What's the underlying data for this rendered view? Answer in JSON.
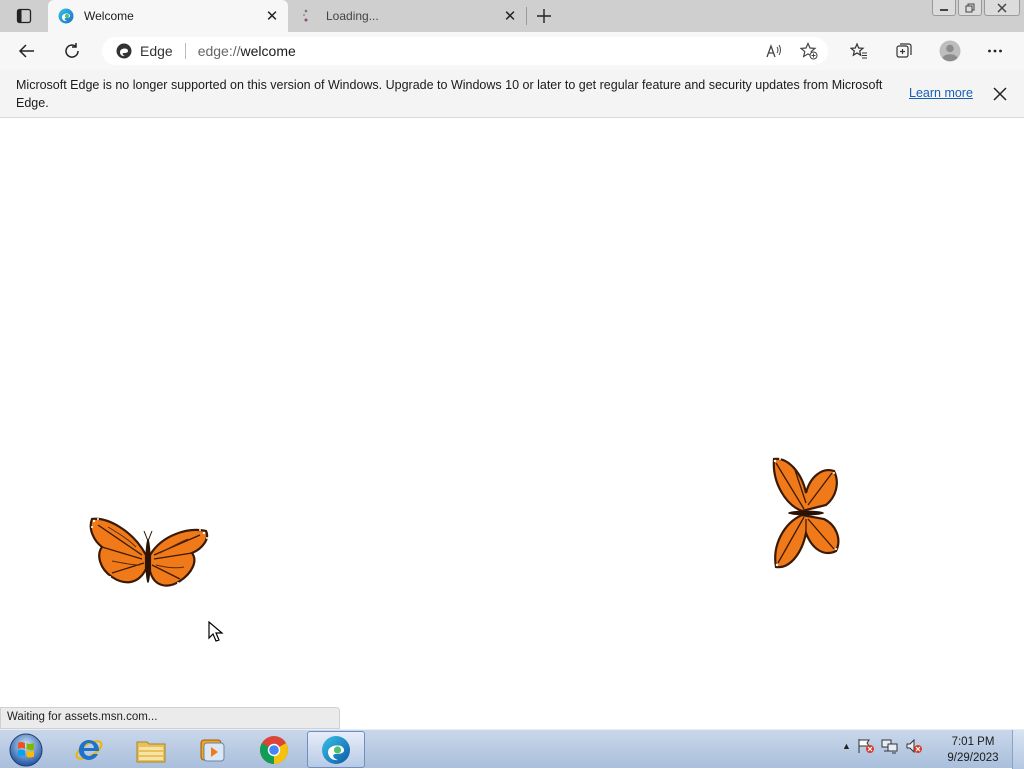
{
  "tabs": [
    {
      "title": "Welcome",
      "icon": "edge-icon",
      "active": true
    },
    {
      "title": "Loading...",
      "icon": "loading-spinner-icon",
      "active": false
    }
  ],
  "address_bar": {
    "site_label": "Edge",
    "url": "edge://welcome",
    "url_scheme": "edge://",
    "url_rest": "welcome"
  },
  "infobar": {
    "message": "Microsoft Edge is no longer supported on this version of Windows. Upgrade to Windows 10 or later to get regular feature and security updates from Microsoft Edge.",
    "link_label": "Learn more"
  },
  "status_text": "Waiting for assets.msn.com...",
  "taskbar": {
    "apps": [
      {
        "name": "internet-explorer-icon",
        "active": false
      },
      {
        "name": "file-explorer-icon",
        "active": false
      },
      {
        "name": "media-player-icon",
        "active": false
      },
      {
        "name": "chrome-icon",
        "active": false
      },
      {
        "name": "edge-icon",
        "active": true
      }
    ],
    "clock_time": "7:01 PM",
    "clock_date": "9/29/2023"
  },
  "colors": {
    "accent": "#1a5fb4",
    "butterfly": "#f07a1a",
    "taskbar": "#b7cbe6"
  }
}
